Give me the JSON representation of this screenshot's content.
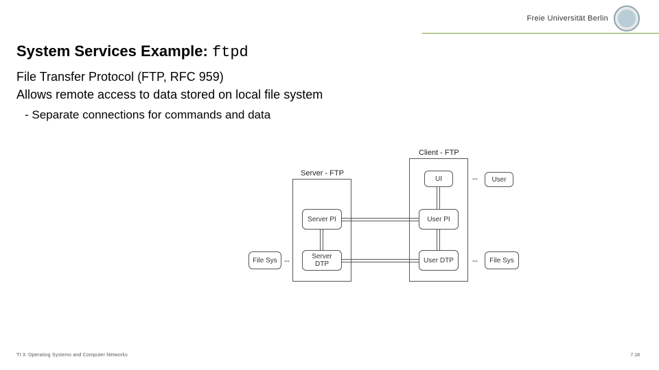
{
  "header": {
    "university_name": "Freie Universität Berlin"
  },
  "title": {
    "prefix": "System Services Example: ",
    "code": "ftpd"
  },
  "body": {
    "line1": "File Transfer Protocol (FTP, RFC 959)",
    "line2": "Allows remote access to data stored on local file system",
    "bullet1": "Separate connections for commands and data"
  },
  "diagram": {
    "server_group": "Server - FTP",
    "client_group": "Client - FTP",
    "server_pi": "Server PI",
    "server_dtp": "Server DTP",
    "ui": "UI",
    "user_pi": "User PI",
    "user_dtp": "User DTP",
    "file_sys_left": "File Sys",
    "file_sys_right": "File Sys",
    "user": "User"
  },
  "footer": {
    "left": "TI 3: Operating Systems and Computer Networks",
    "right": "7.18"
  }
}
